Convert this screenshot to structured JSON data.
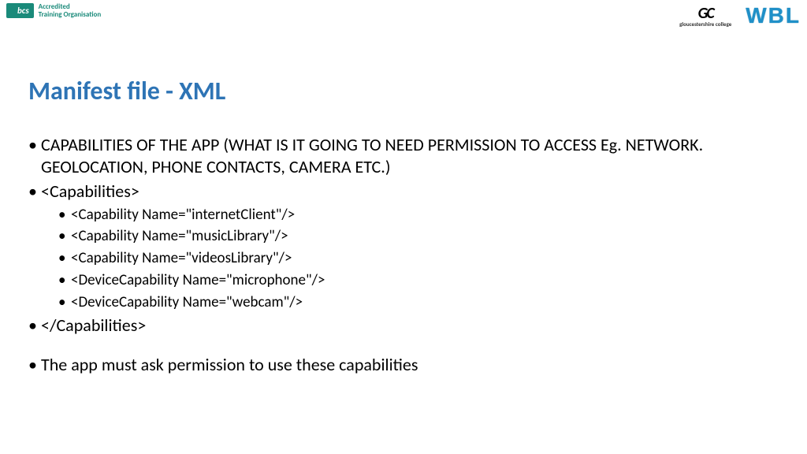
{
  "header": {
    "left_logo": {
      "mark": "bcs",
      "line1": "Accredited",
      "line2": "Training Organisation"
    },
    "right_logos": {
      "gc_mark": "GC",
      "gc_sub": "gloucestershire college",
      "wbl": "WBL"
    }
  },
  "title": "Manifest file  - XML",
  "bullets": {
    "b0": "CAPABILITIES OF THE APP (WHAT IS IT GOING TO NEED PERMISSION TO ACCESS Eg. NETWORK. GEOLOCATION, PHONE CONTACTS, CAMERA ETC.)",
    "b1": "<Capabilities>",
    "b1a": "<Capability Name=\"internetClient\"/>",
    "b1b": "<Capability Name=\"musicLibrary\"/>",
    "b1c": "<Capability Name=\"videosLibrary\"/>",
    "b1d": "<DeviceCapability Name=\"microphone\"/>",
    "b1e": "<DeviceCapability Name=\"webcam\"/>",
    "b2": "</Capabilities>",
    "b3": "The app must ask permission to use these capabilities"
  }
}
